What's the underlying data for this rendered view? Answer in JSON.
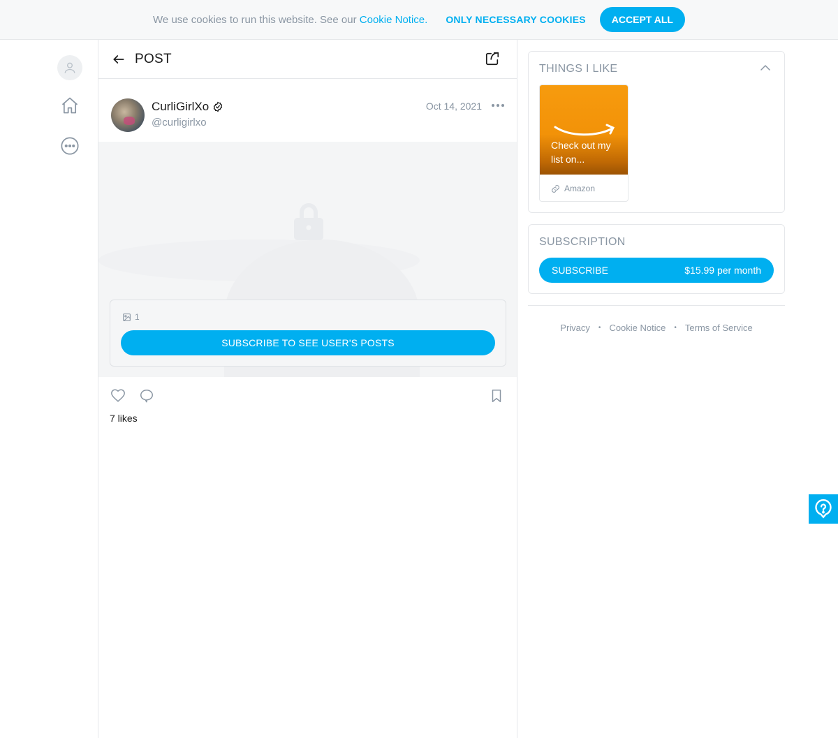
{
  "cookie_bar": {
    "text": "We use cookies to run this website. See our ",
    "link": "Cookie Notice.",
    "necessary_label": "ONLY NECESSARY COOKIES",
    "accept_label": "ACCEPT ALL"
  },
  "nav": {
    "icons": [
      "user-icon",
      "home-icon",
      "more-circle-icon"
    ]
  },
  "post": {
    "header_title": "POST",
    "author_name": "CurliGirlXo",
    "author_handle": "@curligirlxo",
    "date": "Oct 14, 2021",
    "media_count": "1",
    "subscribe_label": "SUBSCRIBE TO SEE USER'S POSTS",
    "likes": "7 likes"
  },
  "things_i_like": {
    "title": "THINGS I LIKE",
    "items": [
      {
        "caption": "Check out my list on...",
        "source": "Amazon"
      }
    ]
  },
  "subscription": {
    "title": "SUBSCRIPTION",
    "button_label": "SUBSCRIBE",
    "price": "$15.99 per month"
  },
  "footer": {
    "privacy": "Privacy",
    "cookie_notice": "Cookie Notice",
    "terms": "Terms of Service"
  },
  "colors": {
    "accent": "#00aff0",
    "muted_text": "#8a96a3",
    "border": "#e5e7ea"
  }
}
